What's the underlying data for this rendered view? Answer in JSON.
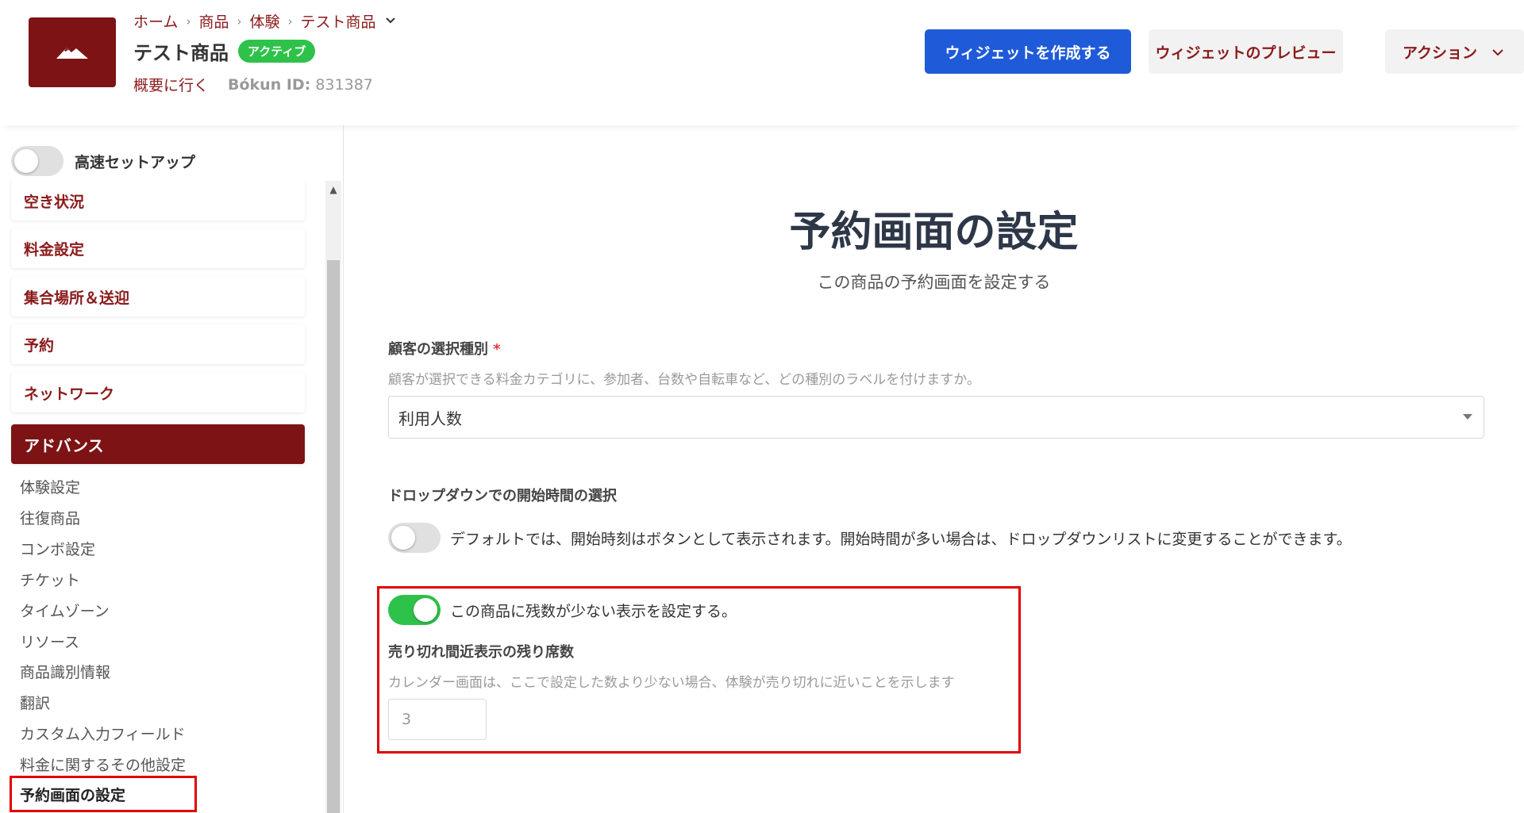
{
  "header": {
    "breadcrumb": [
      "ホーム",
      "商品",
      "体験",
      "テスト商品"
    ],
    "breadcrumb_separator": "›",
    "product_title": "テスト商品",
    "status_badge": "アクティブ",
    "overview_link": "概要に行く",
    "bokun_id_label": "Bókun ID:",
    "bokun_id_value": "831387",
    "create_widget_button": "ウィジェットを作成する",
    "widget_preview_button": "ウィジェットのプレビュー",
    "actions_button": "アクション"
  },
  "sidebar": {
    "quick_setup_label": "高速セットアップ",
    "quick_setup_on": false,
    "nav": [
      {
        "label": "空き状況"
      },
      {
        "label": "料金設定"
      },
      {
        "label": "集合場所＆送迎"
      },
      {
        "label": "予約"
      },
      {
        "label": "ネットワーク"
      },
      {
        "label": "アドバンス",
        "active": true
      }
    ],
    "sub_items": [
      "体験設定",
      "往復商品",
      "コンボ設定",
      "チケット",
      "タイムゾーン",
      "リソース",
      "商品識別情報",
      "翻訳",
      "カスタム入力フィールド",
      "料金に関するその他設定",
      "予約画面の設定"
    ],
    "current_sub_item": "予約画面の設定"
  },
  "main": {
    "title": "予約画面の設定",
    "subtitle": "この商品の予約画面を設定する",
    "customer_type": {
      "label": "顧客の選択種別",
      "required_mark": "*",
      "help": "顧客が選択できる料金カテゴリに、参加者、台数や自転車など、どの種別のラベルを付けますか。",
      "value": "利用人数"
    },
    "dropdown_start_time": {
      "label": "ドロップダウンでの開始時間の選択",
      "toggle_text": "デフォルトでは、開始時刻はボタンとして表示されます。開始時間が多い場合は、ドロップダウンリストに変更することができます。",
      "enabled": false
    },
    "low_stock": {
      "toggle_text": "この商品に残数が少ない表示を設定する。",
      "enabled": true,
      "threshold_label": "売り切れ間近表示の残り席数",
      "threshold_help": "カレンダー画面は、ここで設定した数より少ない場合、体験が売り切れに近いことを示します",
      "threshold_value": "3"
    }
  },
  "colors": {
    "brand": "#7d1315",
    "link": "#8b1a1a",
    "primary_button": "#1f5bd8",
    "toggle_on": "#2ec24a",
    "highlight": "#e00000"
  }
}
